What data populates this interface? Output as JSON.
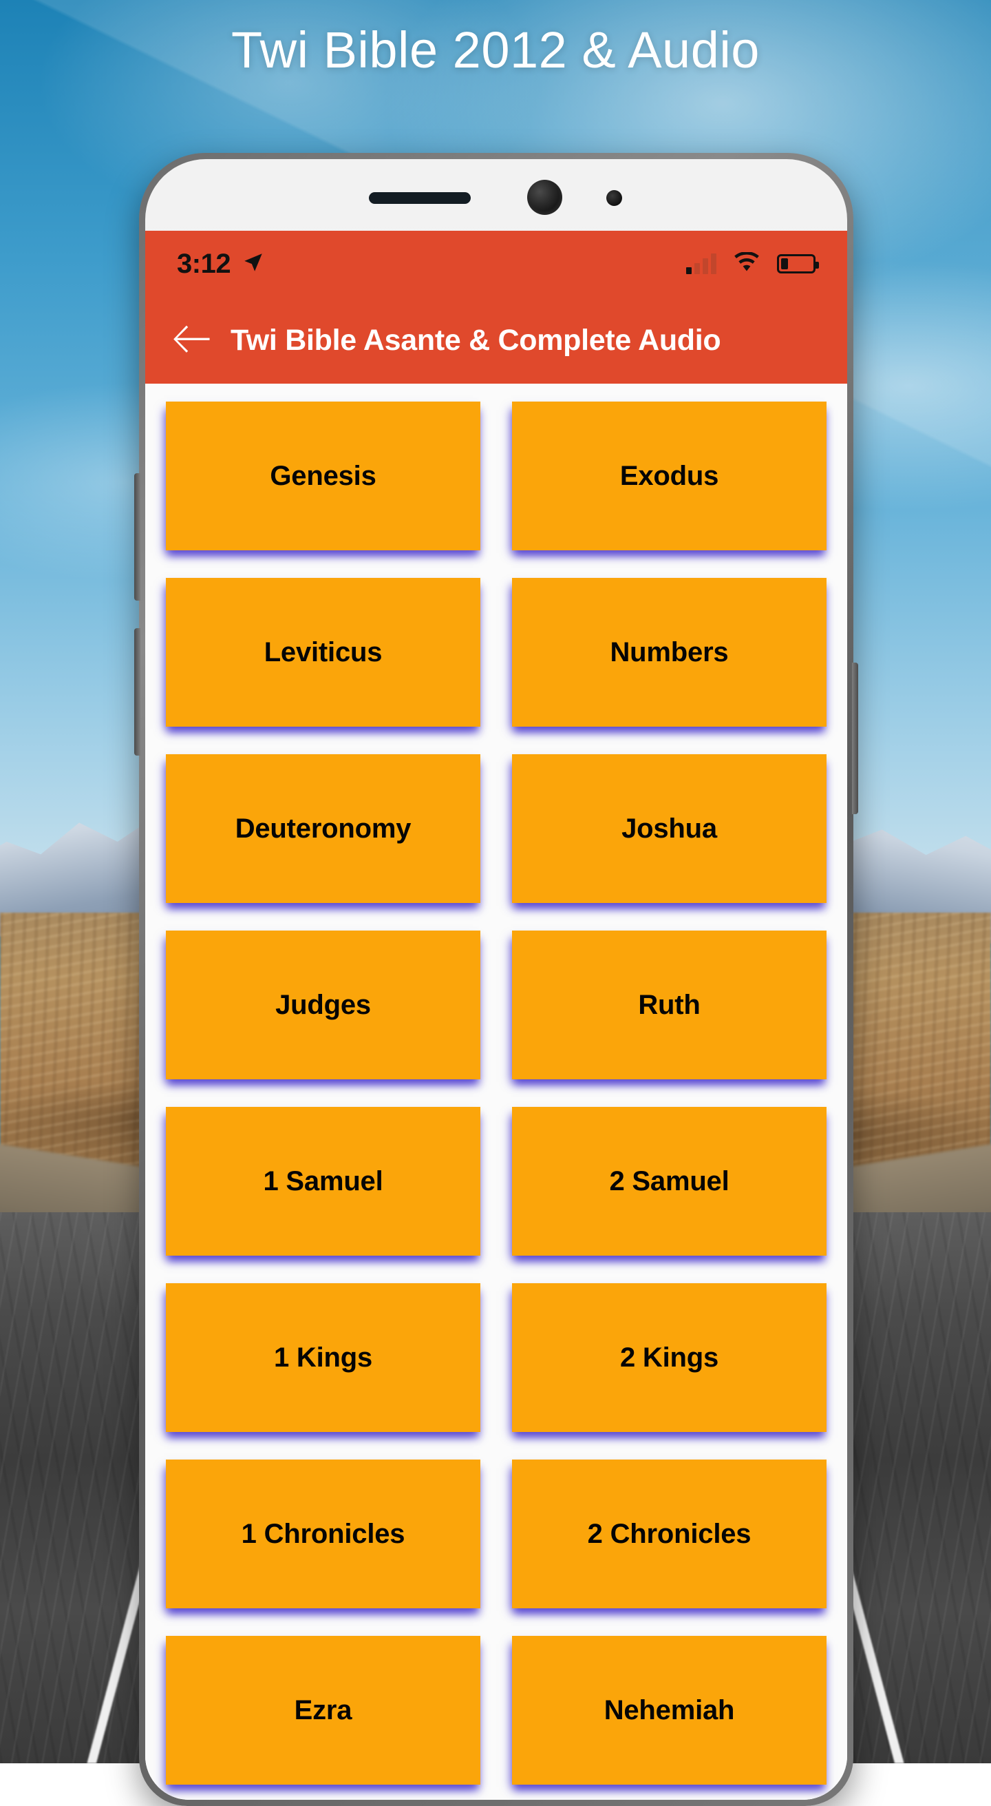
{
  "page": {
    "title": "Twi Bible 2012 & Audio",
    "title_color": "#ffffff",
    "background": "highway-through-desert-with-snowy-mountains"
  },
  "phone": {
    "hardware": {
      "earpiece": "earpiece-speaker",
      "camera": "front-camera",
      "sensor": "proximity-sensor",
      "volume_up": "volume-up-button",
      "volume_down": "volume-down-button",
      "power": "power-button"
    }
  },
  "status_bar": {
    "background": "#e0492c",
    "time": "3:12",
    "location_icon": "location-arrow-icon",
    "signal_icon": "cellular-signal-icon",
    "signal_bars_filled": 1,
    "signal_bars_total": 4,
    "wifi_icon": "wifi-icon",
    "battery_icon": "battery-low-icon",
    "battery_level_percent": 22
  },
  "app_bar": {
    "background": "#e0492c",
    "back_icon": "back-arrow-icon",
    "title": "Twi Bible Asante & Complete Audio"
  },
  "books": {
    "button_color": "#fba50a",
    "text_color": "#050505",
    "shadow_color": "#5646d2",
    "columns": 2,
    "items": [
      "Genesis",
      "Exodus",
      "Leviticus",
      "Numbers",
      "Deuteronomy",
      "Joshua",
      "Judges",
      "Ruth",
      "1 Samuel",
      "2 Samuel",
      "1 Kings",
      "2 Kings",
      "1 Chronicles",
      "2 Chronicles",
      "Ezra",
      "Nehemiah"
    ]
  }
}
